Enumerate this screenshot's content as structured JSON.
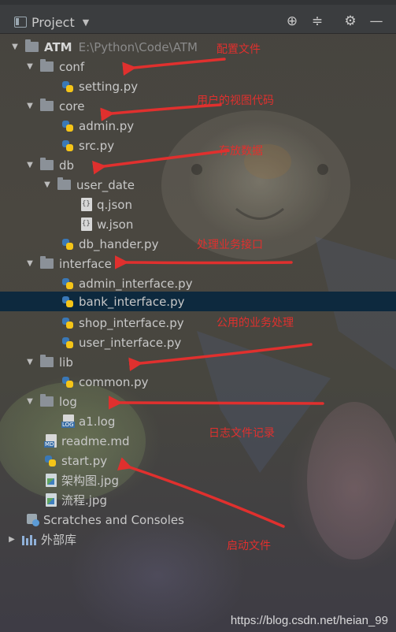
{
  "panel": {
    "title": "Project"
  },
  "toolbar_icons": [
    "crosshair-icon",
    "collapse-icon",
    "gear-icon",
    "minimize-icon"
  ],
  "root": {
    "name": "ATM",
    "path": "E:\\Python\\Code\\ATM"
  },
  "tree": {
    "conf": "conf",
    "setting_py": "setting.py",
    "core": "core",
    "admin_py": "admin.py",
    "src_py": "src.py",
    "db": "db",
    "user_date": "user_date",
    "q_json": "q.json",
    "w_json": "w.json",
    "db_hander_py": "db_hander.py",
    "interface": "interface",
    "admin_interface_py": "admin_interface.py",
    "bank_interface_py": "bank_interface.py",
    "shop_interface_py": "shop_interface.py",
    "user_interface_py": "user_interface.py",
    "lib": "lib",
    "common_py": "common.py",
    "log": "log",
    "a1_log": "a1.log",
    "readme_md": "readme.md",
    "start_py": "start.py",
    "arch_jpg": "架构图.jpg",
    "flow_jpg": "流程.jpg",
    "scratches": "Scratches and Consoles",
    "ext_libs": "外部库"
  },
  "annotations": {
    "conf_note": "配置文件",
    "core_note": "用户的视图代码",
    "db_note": "存放数据",
    "interface_note": "处理业务接口",
    "lib_note": "公用的业务处理",
    "log_note": "日志文件记录",
    "start_note": "启动文件"
  },
  "watermark": "https://blog.csdn.net/heian_99",
  "colors": {
    "annotation": "#e0302e",
    "selection": "#0d293e",
    "python_blue": "#3a78b6",
    "python_yellow": "#f5c518"
  }
}
